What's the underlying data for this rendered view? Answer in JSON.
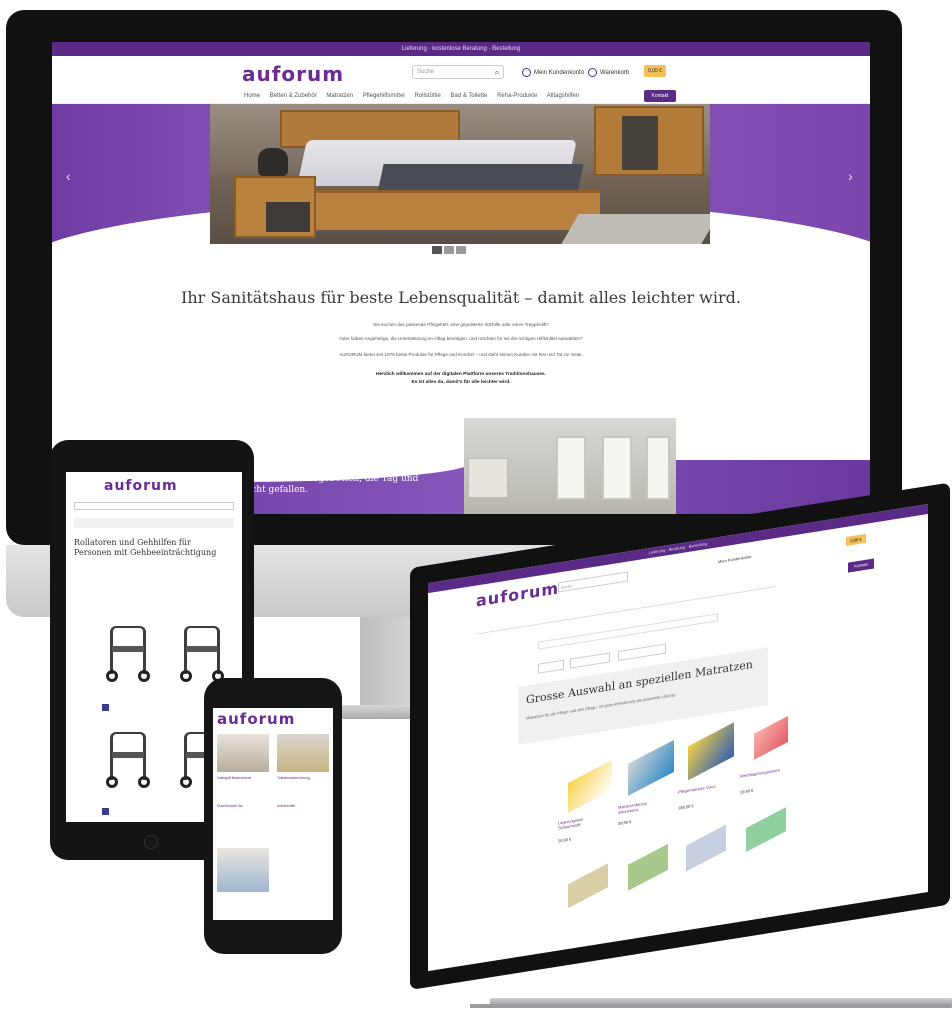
{
  "desktop": {
    "topbar_text": "Lieferung · kostenlose Beratung · Bestellung",
    "logo": "auforum",
    "search_placeholder": "Suche",
    "account_label": "Mein Kundenkonto",
    "wishlist_label": "Warenkorb",
    "cart_label": "0,00 €",
    "nav_items": [
      "Home",
      "Betten & Zubehör",
      "Matratzen",
      "Pflegehilfsmittel",
      "Rollstühle",
      "Bad & Toilette",
      "Reha-Produkte",
      "Alltagshilfen"
    ],
    "nav_button": "Kontakt",
    "slider_prev": "‹",
    "slider_next": "›",
    "headline": "Ihr Sanitätshaus für beste Lebensqualität – damit alles leichter wird.",
    "intro_line_1": "Sie suchen das passende Pflegebett, eine gepolsterte Sitzhilfe oder einen Treppenlift?",
    "intro_line_2": "Oder haben Angehörige, die Unterstützung im Alltag benötigen, und möchten für sie die richtigen Hilfsmittel auswählen?",
    "intro_line_3": "AUFORUM bietet seit 1978 beste Produkte für Pflege und Komfort – und steht seinen Kunden mit Rat und Tat zur Seite.",
    "welcome_line_1": "Herzlich willkommen auf der digitalen Plattform unseres Traditionshauses.",
    "welcome_line_2": "Es ist alles da, damit's für alle leichter wird.",
    "lower_banner_text": "Komfort- und Pflegebetten, die Tag und Nacht gefallen."
  },
  "tablet": {
    "logo": "auforum",
    "heading": "Rollatoren und Gehhilfen für Personen mit Gehbeeinträchtigung"
  },
  "phone": {
    "logo": "auforum",
    "items": [
      "Haltegriff Badezimmer",
      "Toilettensitzerhöhung",
      "Duschhocker Alu",
      "Aufstehhilfe"
    ]
  },
  "laptop": {
    "topbar_text": "Lieferung · Beratung · Bestellung",
    "logo": "auforum",
    "search_placeholder": "Suche",
    "account_label": "Mein Kundenkonto",
    "cart_label": "0,00 €",
    "nav_button": "Kontakt",
    "banner_title": "Grosse Auswahl an speziellen Matratzen",
    "banner_sub": "Matratzen für die Pflege und den Alltag – für jede Anforderung die passende Lösung.",
    "products": [
      {
        "name": "Lagerungskeil Schaumstoff",
        "price": "29,90 €"
      },
      {
        "name": "Matratzenbezug Inkontinenz",
        "price": "39,90 €"
      },
      {
        "name": "Pflegematratze Visco",
        "price": "189,00 €"
      },
      {
        "name": "Weichlagerungskissen",
        "price": "19,90 €"
      }
    ]
  },
  "colors": {
    "brand_purple": "#6a2c91",
    "accent_yellow": "#f3c15a"
  }
}
